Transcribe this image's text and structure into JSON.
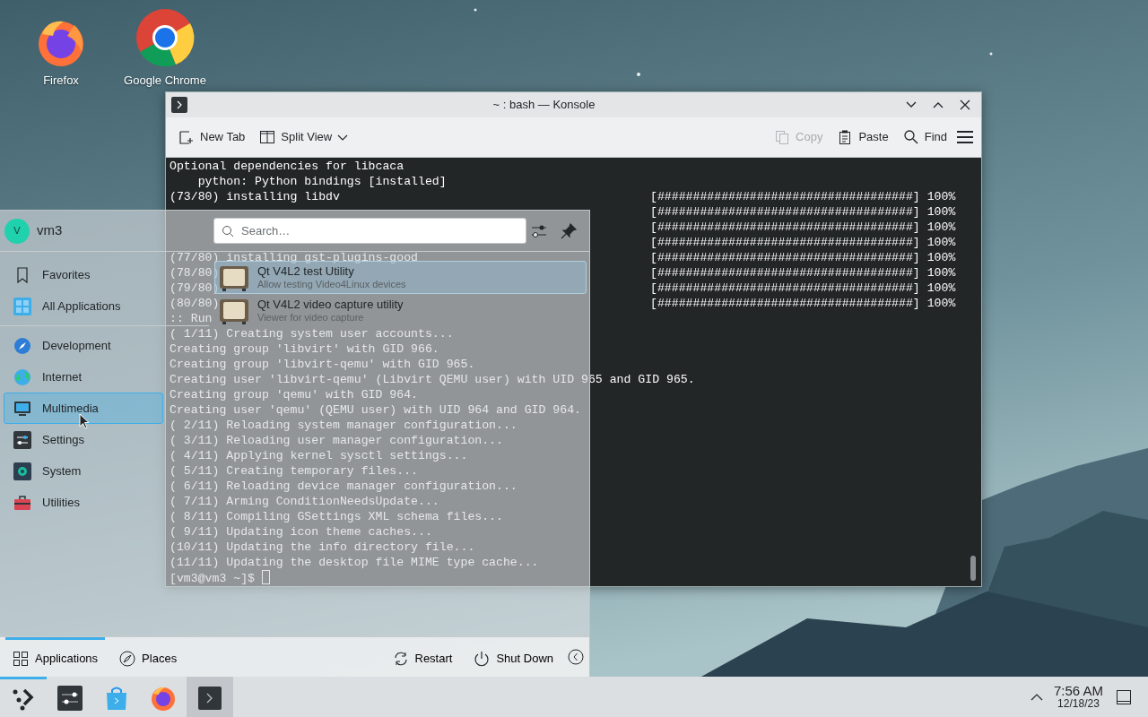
{
  "desktop_icons": [
    {
      "label": "Firefox"
    },
    {
      "label": "Google Chrome"
    }
  ],
  "konsole": {
    "title": "~ : bash — Konsole",
    "toolbar": [
      {
        "label": "New Tab",
        "disabled": false
      },
      {
        "label": "Split View",
        "disabled": false
      },
      {
        "label": "Copy",
        "disabled": true
      },
      {
        "label": "Paste",
        "disabled": false
      },
      {
        "label": "Find",
        "disabled": false
      }
    ],
    "lines": [
      {
        "text": "Optional dependencies for libcaca"
      },
      {
        "text": "    python: Python bindings [installed]"
      },
      {
        "text": "(73/80) installing libdv",
        "bar": "[####################################] 100%"
      },
      {
        "bar": "[####################################] 100%"
      },
      {
        "bar": "[####################################] 100%"
      },
      {
        "bar": "[####################################] 100%"
      },
      {
        "text": "(77/80) installing gst-plugins-good",
        "bar": "[####################################] 100%"
      },
      {
        "text": "(78/80)",
        "bar": "[####################################] 100%"
      },
      {
        "text": "(79/80)",
        "bar": "[####################################] 100%"
      },
      {
        "text": "(80/80)",
        "bar": "[####################################] 100%"
      },
      {
        "text": ":: Run"
      },
      {
        "text": "( 1/11) Creating system user accounts..."
      },
      {
        "text": "Creating group 'libvirt' with GID 966."
      },
      {
        "text": "Creating group 'libvirt-qemu' with GID 965."
      },
      {
        "text": "Creating user 'libvirt-qemu' (Libvirt QEMU user) with UID 965 and GID 965."
      },
      {
        "text": "Creating group 'qemu' with GID 964."
      },
      {
        "text": "Creating user 'qemu' (QEMU user) with UID 964 and GID 964."
      },
      {
        "text": "( 2/11) Reloading system manager configuration..."
      },
      {
        "text": "( 3/11) Reloading user manager configuration..."
      },
      {
        "text": "( 4/11) Applying kernel sysctl settings..."
      },
      {
        "text": "( 5/11) Creating temporary files..."
      },
      {
        "text": "( 6/11) Reloading device manager configuration..."
      },
      {
        "text": "( 7/11) Arming ConditionNeedsUpdate..."
      },
      {
        "text": "( 8/11) Compiling GSettings XML schema files..."
      },
      {
        "text": "( 9/11) Updating icon theme caches..."
      },
      {
        "text": "(10/11) Updating the info directory file..."
      },
      {
        "text": "(11/11) Updating the desktop file MIME type cache..."
      }
    ],
    "prompt": "[vm3@vm3 ~]$ "
  },
  "launcher": {
    "user": {
      "initial": "V",
      "name": "vm3"
    },
    "search": {
      "placeholder": "Search…"
    },
    "sidebar": {
      "top": [
        {
          "label": "Favorites",
          "selected": false
        },
        {
          "label": "All Applications",
          "selected": false
        }
      ],
      "categories": [
        {
          "label": "Development",
          "selected": false
        },
        {
          "label": "Internet",
          "selected": false
        },
        {
          "label": "Multimedia",
          "selected": true
        },
        {
          "label": "Settings",
          "selected": false
        },
        {
          "label": "System",
          "selected": false
        },
        {
          "label": "Utilities",
          "selected": false
        }
      ]
    },
    "results": [
      {
        "title": "Qt V4L2 test Utility",
        "subtitle": "Allow testing Video4Linux devices",
        "selected": true
      },
      {
        "title": "Qt V4L2 video capture utility",
        "subtitle": "Viewer for video capture",
        "selected": false
      }
    ],
    "tabs": [
      {
        "label": "Applications",
        "selected": true
      },
      {
        "label": "Places",
        "selected": false
      }
    ],
    "actions": [
      {
        "label": "Restart"
      },
      {
        "label": "Shut Down"
      }
    ]
  },
  "taskbar": {
    "items": [
      {
        "active": false
      },
      {
        "active": false
      },
      {
        "active": false
      },
      {
        "active": false
      },
      {
        "active": true
      }
    ],
    "launcher_open": true,
    "clock": {
      "time": "7:56 AM",
      "date": "12/18/23"
    }
  }
}
